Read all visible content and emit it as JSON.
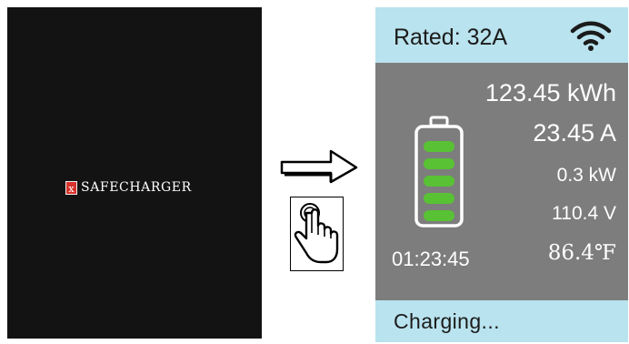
{
  "splash": {
    "logo_letter": "x",
    "brand_name": "SAFECHARGER"
  },
  "gestures": {
    "swipe_icon": "right-arrow-icon",
    "tap_icon": "tap-hand-icon"
  },
  "charging_screen": {
    "rated": "Rated: 32A",
    "wifi_icon": "wifi-icon",
    "energy": "123.45 kWh",
    "current": "23.45 A",
    "power": "0.3 kW",
    "voltage": "110.4 V",
    "elapsed_time": "01:23:45",
    "temperature": "86.4℉",
    "battery_icon": "battery-icon",
    "battery_filled_bars": 5,
    "status": "Charging..."
  },
  "colors": {
    "screen_background": "#b9e3ee",
    "panel_background": "#7d7d7d",
    "battery_fill": "#58c234",
    "splash_background": "#131313"
  }
}
